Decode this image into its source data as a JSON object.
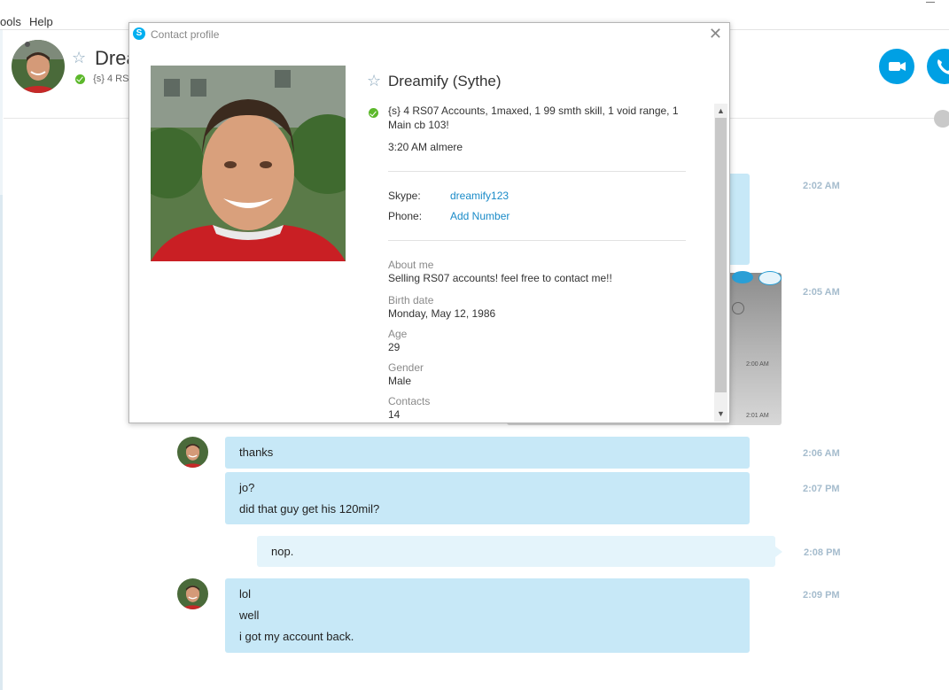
{
  "menu": {
    "tools": "ools",
    "help": "Help"
  },
  "header": {
    "name_truncated": "Drea",
    "status_truncated": "{s} 4 RS"
  },
  "dialog": {
    "title": "Contact profile",
    "close_glyph": "✕",
    "name": "Dreamify (Sythe)",
    "mood": "{s} 4 RS07 Accounts, 1maxed, 1 99 smth skill, 1 void range, 1 Main cb 103!",
    "local_time": "3:20 AM almere",
    "skype_label": "Skype:",
    "skype_value": "dreamify123",
    "phone_label": "Phone:",
    "phone_value": "Add Number",
    "about_label": "About me",
    "about_value": "Selling RS07 accounts! feel free to contact me!!",
    "birth_label": "Birth date",
    "birth_value": "Monday, May 12, 1986",
    "age_label": "Age",
    "age_value": "29",
    "gender_label": "Gender",
    "gender_value": "Male",
    "contacts_label": "Contacts",
    "contacts_value": "14"
  },
  "background": {
    "img_time1": "2:00 AM",
    "img_time2": "2:01 AM"
  },
  "messages": [
    {
      "time": "2:02 AM"
    },
    {
      "time": "2:05 AM"
    },
    {
      "lines": [
        "thanks"
      ],
      "time": "2:06 AM"
    },
    {
      "lines": [
        "jo?",
        "did that guy get his 120mil?"
      ],
      "time": "2:07 PM"
    },
    {
      "lines": [
        "nop."
      ],
      "time": "2:08 PM"
    },
    {
      "lines": [
        "lol",
        "well",
        "i got my account back."
      ],
      "time": "2:09 PM"
    }
  ],
  "icons": {
    "star": "☆",
    "arrow_up": "▲",
    "arrow_down": "▼",
    "skype": "S"
  },
  "colors": {
    "accent": "#00a0e4",
    "bubble_contact": "#c7e8f7",
    "bubble_self": "#e4f4fb",
    "status_online": "#5cb82b",
    "link": "#1a8bc8"
  }
}
